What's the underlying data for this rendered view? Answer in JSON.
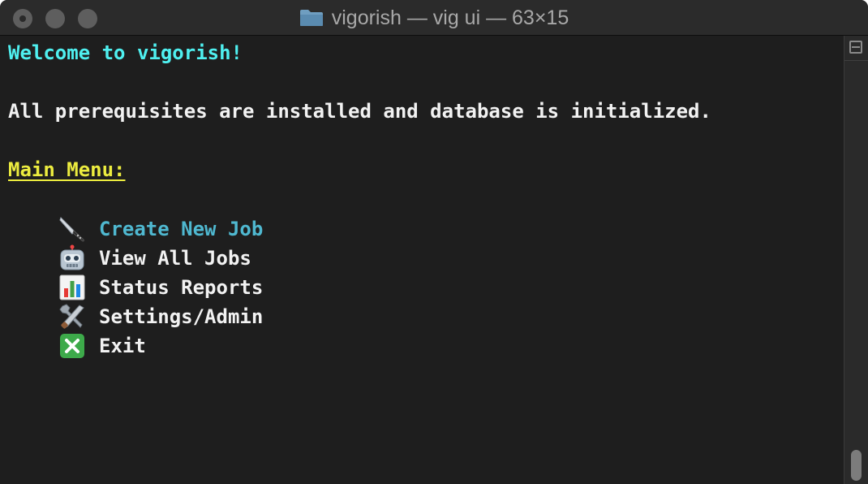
{
  "window": {
    "title": "vigorish — vig ui — 63×15"
  },
  "terminal": {
    "welcome": "Welcome to vigorish!",
    "prereq_message": "All prerequisites are installed and database is initialized.",
    "menu_heading": "Main Menu:",
    "menu_items": [
      {
        "icon": "knife-icon",
        "label": "Create New Job",
        "selected": true
      },
      {
        "icon": "robot-icon",
        "label": "View All Jobs",
        "selected": false
      },
      {
        "icon": "bar-chart-icon",
        "label": "Status Reports",
        "selected": false
      },
      {
        "icon": "tools-icon",
        "label": "Settings/Admin",
        "selected": false
      },
      {
        "icon": "cross-mark-icon",
        "label": "Exit",
        "selected": false
      }
    ]
  },
  "colors": {
    "background": "#1e1e1e",
    "welcome": "#4ff0f0",
    "heading": "#ecec3f",
    "selected": "#4fb8d0",
    "text": "#f2f2f2"
  }
}
